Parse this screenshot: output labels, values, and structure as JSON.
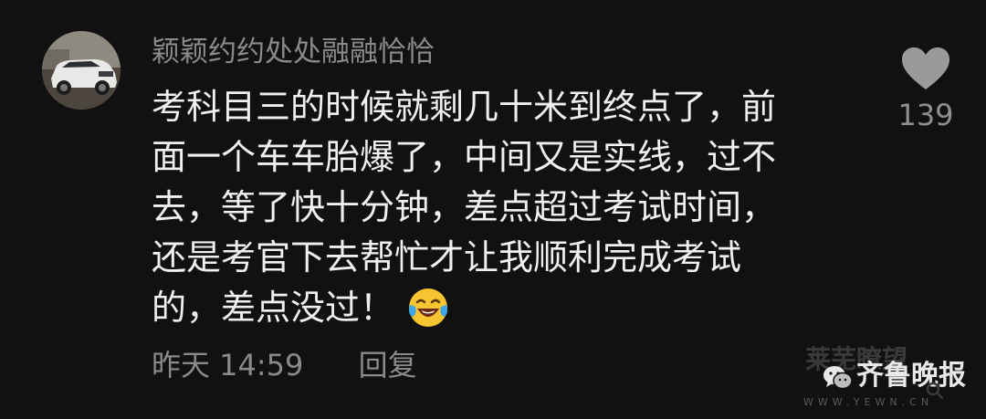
{
  "comment": {
    "username": "颖颖约约处处融融恰恰",
    "avatar_icon": "car-avatar",
    "text_lines": [
      "考科目三的时候就剩几十米到终点了，前",
      "面一个车车胎爆了，中间又是实线，过不",
      "去，等了快十分钟，差点超过考试时间，",
      "还是考官下去帮忙才让我顺利完成考试",
      "的，差点没过！"
    ],
    "emoji_icon": "laughing-crying-emoji",
    "time": "昨天 14:59",
    "reply_label": "回复"
  },
  "like": {
    "icon": "heart-icon",
    "count": "139"
  },
  "watermark": {
    "faded_text": "莱芜瞭望",
    "brand_icon": "wechat-icon",
    "brand": "齐鲁晚报",
    "url": "WWW.YEWN.CN"
  },
  "colors": {
    "background": "#111111",
    "text": "#f0f0f0",
    "muted": "#8a8a8a",
    "emoji_yellow": "#f7c531",
    "emoji_tears": "#3ea6e8"
  }
}
